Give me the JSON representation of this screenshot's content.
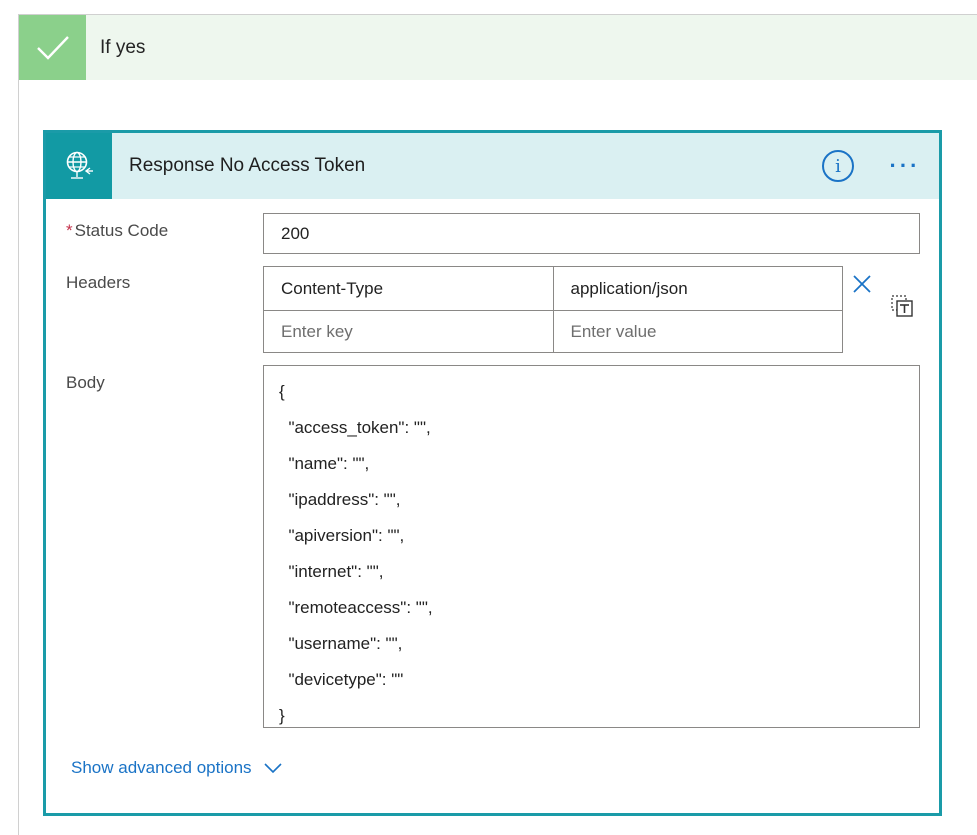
{
  "condition": {
    "title": "If yes",
    "icon": "checkmark-icon",
    "color": "#8bd08b"
  },
  "action": {
    "title": "Response No Access Token",
    "icon": "http-response-globe-icon",
    "accent": "#129aa4",
    "info_icon": "info-icon",
    "info_glyph": "i",
    "more_icon": "more-ellipsis-icon",
    "more_glyph": "···"
  },
  "fields": {
    "status_code": {
      "required_mark": "*",
      "label": "Status Code",
      "value": "200"
    },
    "headers": {
      "label": "Headers",
      "rows": [
        {
          "key": "Content-Type",
          "value": "application/json"
        }
      ],
      "empty_row": {
        "key_placeholder": "Enter key",
        "value_placeholder": "Enter value"
      },
      "remove_icon": "close-x-icon",
      "text_mode_icon": "switch-to-text-mode-icon"
    },
    "body": {
      "label": "Body",
      "lines": [
        "{",
        "  \"access_token\": \"\",",
        "  \"name\": \"\",",
        "  \"ipaddress\": \"\",",
        "  \"apiversion\": \"\",",
        "  \"internet\": \"\",",
        "  \"remoteaccess\": \"\",",
        "  \"username\": \"\",",
        "  \"devicetype\": \"\"",
        "}"
      ]
    }
  },
  "advanced": {
    "label": "Show advanced options",
    "icon": "chevron-down-icon"
  }
}
